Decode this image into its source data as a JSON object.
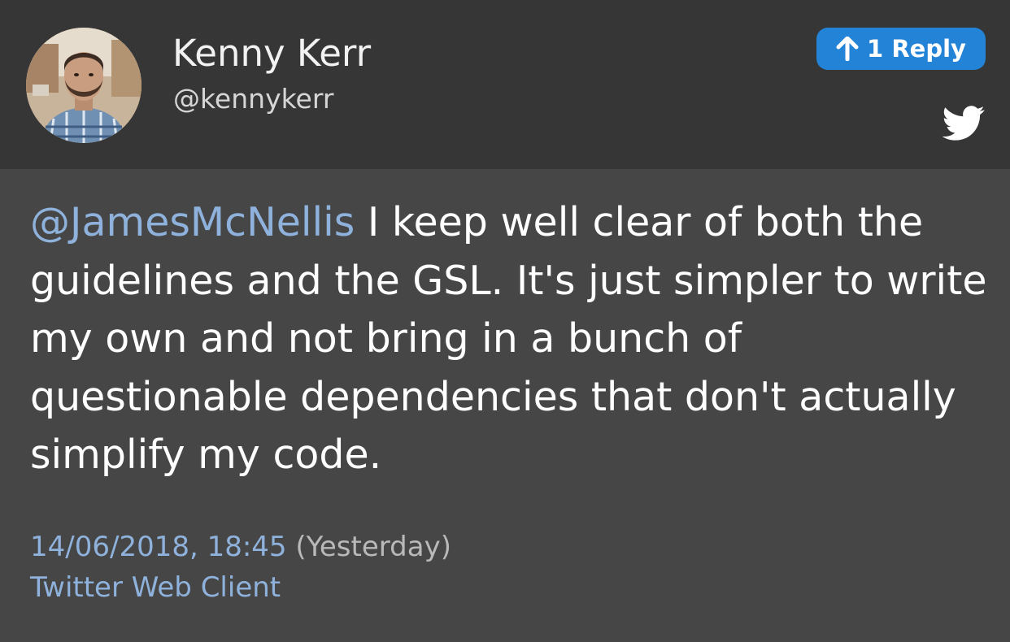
{
  "author": {
    "name": "Kenny Kerr",
    "handle": "@kennykerr"
  },
  "reply_button": {
    "label": "1 Reply",
    "icon": "arrow-up-icon",
    "color": "#2383d7"
  },
  "header": {
    "brand_icon": "twitter-bird-icon"
  },
  "tweet": {
    "mention": "@JamesMcNellis",
    "body": " I keep well clear of both the guidelines and the GSL. It's just simpler to write my own and not bring in a bunch of questionable dependencies that don't actually simplify my code.",
    "timestamp": "14/06/2018, 18:45",
    "relative_time": "(Yesterday)",
    "client": "Twitter Web Client"
  },
  "colors": {
    "background": "#464646",
    "header_background": "#363636",
    "link": "#8fb2dc"
  }
}
